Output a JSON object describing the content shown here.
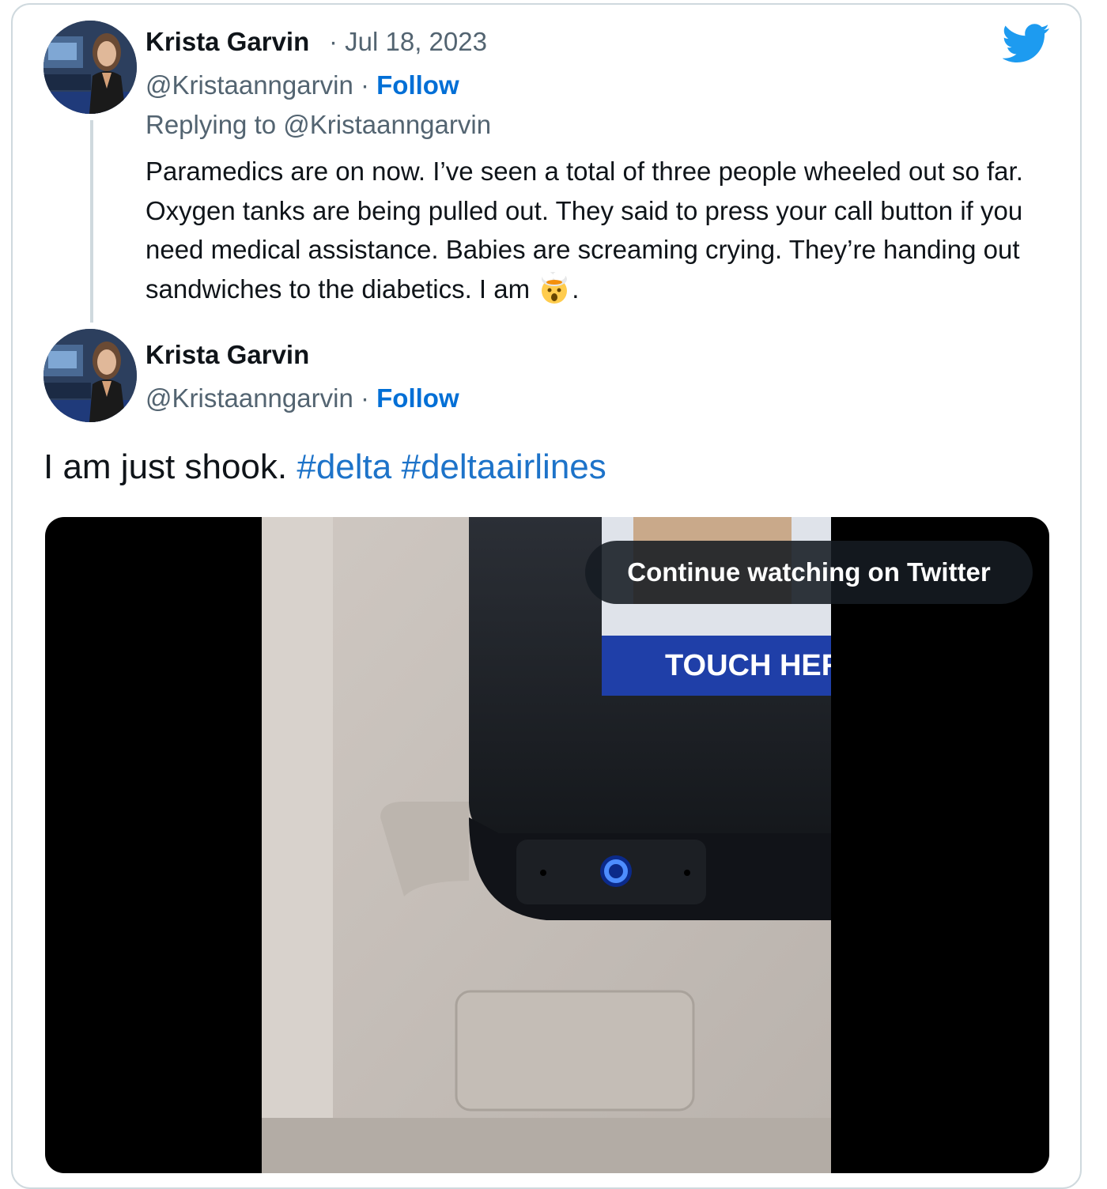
{
  "icons": {
    "twitter_logo": "twitter-bird-icon",
    "emoji": "exploding-head-emoji"
  },
  "colors": {
    "follow": "#006fd6",
    "hashtag": "#1d73c9",
    "twitter_brand": "#1d9bf0",
    "secondary_text": "#536471"
  },
  "reply_tweet": {
    "author_name": "Krista Garvin",
    "separator_date": "· Jul 18, 2023",
    "handle": "@Kristaanngarvin",
    "separator": "·",
    "follow_label": "Follow",
    "replying_to": "Replying to @Kristaanngarvin",
    "text": "Paramedics are on now. I’ve seen a total of three people wheeled out so far. Oxygen tanks are being pulled out. They said to press your call button if you need medical assistance. Babies are screaming crying. They’re handing out sandwiches to the diabetics. I am ",
    "text_end": "."
  },
  "main_tweet": {
    "author_name": "Krista Garvin",
    "handle": "@Kristaanngarvin",
    "separator": "·",
    "follow_label": "Follow",
    "text": "I am just shook. ",
    "hashtag_1": "#delta",
    "hashtag_2": "#deltaairlines"
  },
  "video": {
    "continue_label": "Continue watching on Twitter",
    "screen_text": "TOUCH HERE T"
  }
}
